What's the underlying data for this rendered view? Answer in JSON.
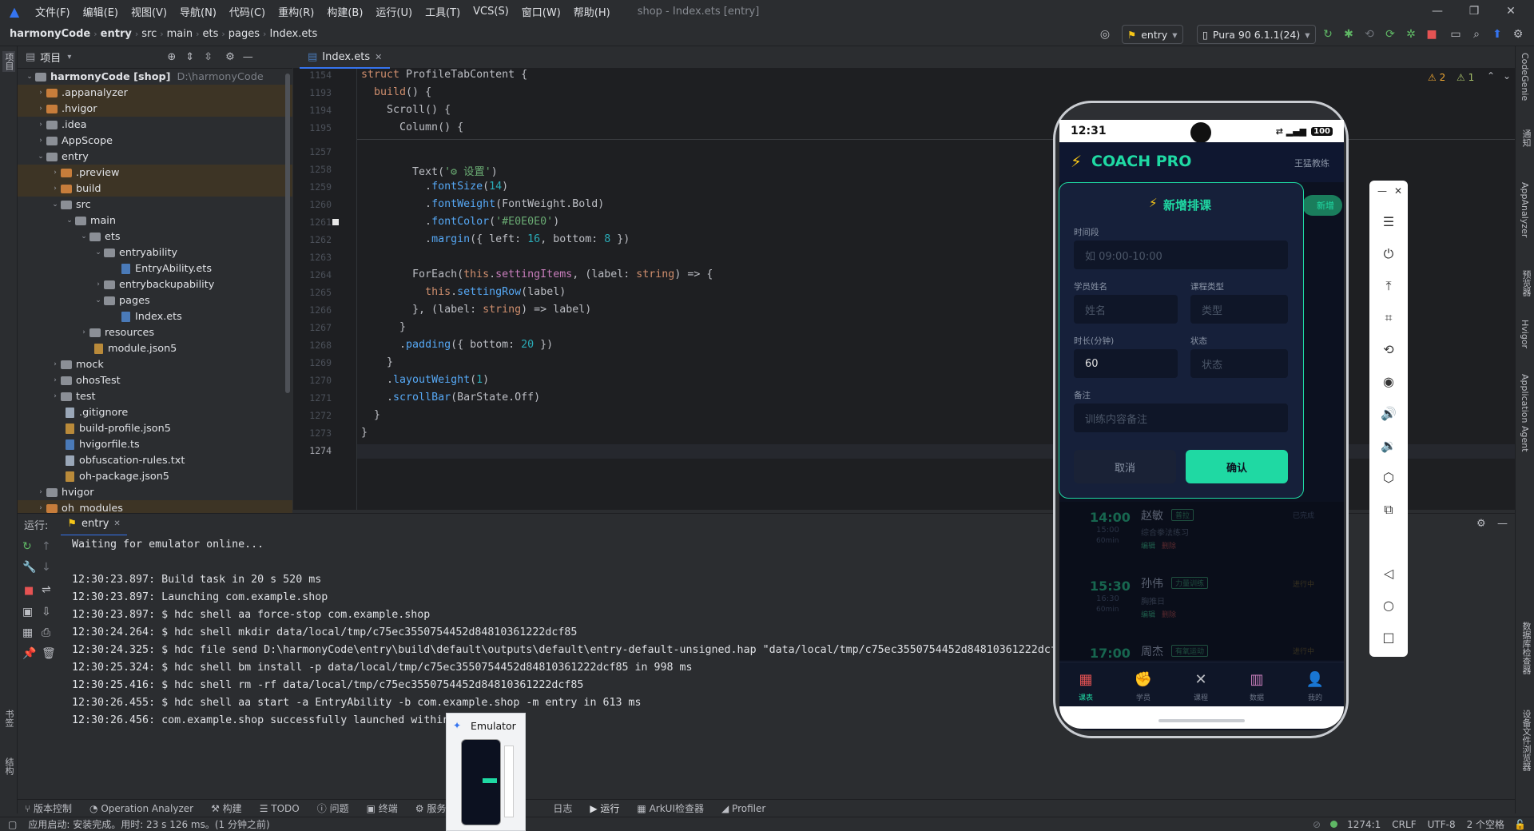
{
  "menubar": {
    "items": [
      "文件(F)",
      "编辑(E)",
      "视图(V)",
      "导航(N)",
      "代码(C)",
      "重构(R)",
      "构建(B)",
      "运行(U)",
      "工具(T)",
      "VCS(S)",
      "窗口(W)",
      "帮助(H)"
    ],
    "window_title": "shop - Index.ets [entry]"
  },
  "navbar": {
    "breadcrumb": [
      "harmonyCode",
      "entry",
      "src",
      "main",
      "ets",
      "pages",
      "Index.ets"
    ],
    "run_config": "entry",
    "device": "Pura 90 6.1.1(24)"
  },
  "left_strip": {
    "project_label": "项目",
    "bookmarks_label": "书签",
    "structure_label": "结构"
  },
  "project_panel": {
    "title": "项目",
    "root_name": "harmonyCode [shop]",
    "root_path": "D:\\harmonyCode",
    "items": [
      {
        "label": ".appanalyzer"
      },
      {
        "label": ".hvigor"
      },
      {
        "label": ".idea"
      },
      {
        "label": "AppScope"
      },
      {
        "label": "entry"
      },
      {
        "label": ".preview"
      },
      {
        "label": "build"
      },
      {
        "label": "src"
      },
      {
        "label": "main"
      },
      {
        "label": "ets"
      },
      {
        "label": "entryability"
      },
      {
        "label": "EntryAbility.ets"
      },
      {
        "label": "entrybackupability"
      },
      {
        "label": "pages"
      },
      {
        "label": "Index.ets"
      },
      {
        "label": "resources"
      },
      {
        "label": "module.json5"
      },
      {
        "label": "mock"
      },
      {
        "label": "ohosTest"
      },
      {
        "label": "test"
      },
      {
        "label": ".gitignore"
      },
      {
        "label": "build-profile.json5"
      },
      {
        "label": "hvigorfile.ts"
      },
      {
        "label": "obfuscation-rules.txt"
      },
      {
        "label": "oh-package.json5"
      },
      {
        "label": "hvigor"
      },
      {
        "label": "oh_modules"
      }
    ]
  },
  "editor": {
    "tab": "Index.ets",
    "warnings": "2",
    "weak_warnings": "1",
    "lines": [
      {
        "n": "1154",
        "t": "struct ProfileTabContent {"
      },
      {
        "n": "1193",
        "t": "  build() {"
      },
      {
        "n": "1194",
        "t": "    Scroll() {"
      },
      {
        "n": "1195",
        "t": "      Column() {"
      },
      {
        "n": "1257",
        "t": ""
      },
      {
        "n": "1258",
        "t": "        Text('⚙ 设置')"
      },
      {
        "n": "1259",
        "t": "          .fontSize(14)"
      },
      {
        "n": "1260",
        "t": "          .fontWeight(FontWeight.Bold)"
      },
      {
        "n": "1261",
        "t": "          .fontColor('#E0E0E0')"
      },
      {
        "n": "1262",
        "t": "          .margin({ left: 16, bottom: 8 })"
      },
      {
        "n": "1263",
        "t": ""
      },
      {
        "n": "1264",
        "t": "        ForEach(this.settingItems, (label: string) => {"
      },
      {
        "n": "1265",
        "t": "          this.settingRow(label)"
      },
      {
        "n": "1266",
        "t": "        }, (label: string) => label)"
      },
      {
        "n": "1267",
        "t": "      }"
      },
      {
        "n": "1268",
        "t": "      .padding({ bottom: 20 })"
      },
      {
        "n": "1269",
        "t": "    }"
      },
      {
        "n": "1270",
        "t": "    .layoutWeight(1)"
      },
      {
        "n": "1271",
        "t": "    .scrollBar(BarState.Off)"
      },
      {
        "n": "1272",
        "t": "  }"
      },
      {
        "n": "1273",
        "t": "}"
      },
      {
        "n": "1274",
        "t": ""
      }
    ]
  },
  "run_panel": {
    "label": "运行:",
    "tab": "entry",
    "console": [
      "Waiting for emulator online...",
      "",
      "12:30:23.897: Build task in 20 s 520 ms",
      "12:30:23.897: Launching com.example.shop",
      "12:30:23.897: $ hdc shell aa force-stop com.example.shop",
      "12:30:24.264: $ hdc shell mkdir data/local/tmp/c75ec3550754452d84810361222dcf85",
      "12:30:24.325: $ hdc file send D:\\harmonyCode\\entry\\build\\default\\outputs\\default\\entry-default-unsigned.hap \"data/local/tmp/c75ec3550754452d84810361222dcf",
      "12:30:25.324: $ hdc shell bm install -p data/local/tmp/c75ec3550754452d84810361222dcf85 in 998 ms",
      "12:30:25.416: $ hdc shell rm -rf data/local/tmp/c75ec3550754452d84810361222dcf85",
      "12:30:26.455: $ hdc shell aa start -a EntryAbility -b com.example.shop -m entry in 613 ms",
      "12:30:26.456: com.example.shop successfully launched within"
    ]
  },
  "emulator_popup": {
    "label": "Emulator"
  },
  "tool_windows": [
    "版本控制",
    "Operation Analyzer",
    "构建",
    "TODO",
    "问题",
    "终端",
    "服务",
    "日志",
    "运行",
    "ArkUI检查器",
    "Profiler"
  ],
  "status": {
    "message": "应用启动: 安装完成。用时: 23 s 126 ms。(1 分钟之前)",
    "position": "1274:1",
    "line_sep": "CRLF",
    "encoding": "UTF-8",
    "indent": "2 个空格"
  },
  "right_strip": [
    "CodeGenie",
    "通知",
    "AppAnalyzer",
    "预览器",
    "Hvigor",
    "Application Agent",
    "数据库检查器",
    "设备文件浏览器"
  ],
  "phone": {
    "time": "12:31",
    "battery": "100",
    "app_title": "COACH PRO",
    "coach_name": "王猛教练",
    "badge": "新增",
    "modal": {
      "title": "新增排课",
      "time_label": "时间段",
      "time_placeholder": "如 09:00-10:00",
      "student_label": "学员姓名",
      "student_placeholder": "姓名",
      "type_label": "课程类型",
      "type_placeholder": "类型",
      "duration_label": "时长(分钟)",
      "duration_value": "60",
      "status_label": "状态",
      "status_placeholder": "状态",
      "note_label": "备注",
      "note_placeholder": "训练内容备注",
      "cancel": "取消",
      "confirm": "确认"
    },
    "schedule": [
      {
        "time": "14:00",
        "end": "15:00",
        "dur": "60min",
        "name": "赵敏",
        "tag": "普拉",
        "desc": "综合拳法练习",
        "edit": "编辑",
        "del": "删除",
        "status": "已完成"
      },
      {
        "time": "15:30",
        "end": "16:30",
        "dur": "60min",
        "name": "孙伟",
        "tag": "力量训练",
        "desc": "胸推日",
        "edit": "编辑",
        "del": "删除",
        "status": "进行中"
      },
      {
        "time": "17:00",
        "end": "",
        "dur": "",
        "name": "周杰",
        "tag": "有氧运动",
        "desc": "",
        "edit": "",
        "del": "",
        "status": "进行中"
      }
    ],
    "tabs": [
      "课表",
      "学员",
      "课程",
      "数据",
      "我的"
    ]
  },
  "colors": {
    "accent": "#1fd9a3",
    "ide_bg": "#1e1f22",
    "panel_bg": "#2b2d30",
    "modal_bg": "#16203a",
    "yellow": "#f5c518"
  }
}
